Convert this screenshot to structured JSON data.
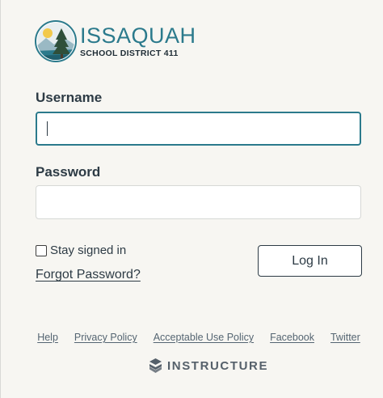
{
  "branding": {
    "district_name": "ISSAQUAH",
    "district_subtitle": "SCHOOL DISTRICT 411",
    "emblem_icon": "tree-lake-emblem-icon",
    "accent_color": "#2b7a8c"
  },
  "login_form": {
    "username_label": "Username",
    "username_value": "",
    "password_label": "Password",
    "password_value": "",
    "stay_signed_in_label": "Stay signed in",
    "stay_signed_in_checked": false,
    "forgot_password_label": "Forgot Password?",
    "login_button_label": "Log In"
  },
  "footer": {
    "links": [
      {
        "label": "Help"
      },
      {
        "label": "Privacy Policy"
      },
      {
        "label": "Acceptable Use Policy"
      },
      {
        "label": "Facebook"
      },
      {
        "label": "Twitter"
      }
    ],
    "brand_label": "INSTRUCTURE",
    "brand_icon": "instructure-logo-icon"
  }
}
